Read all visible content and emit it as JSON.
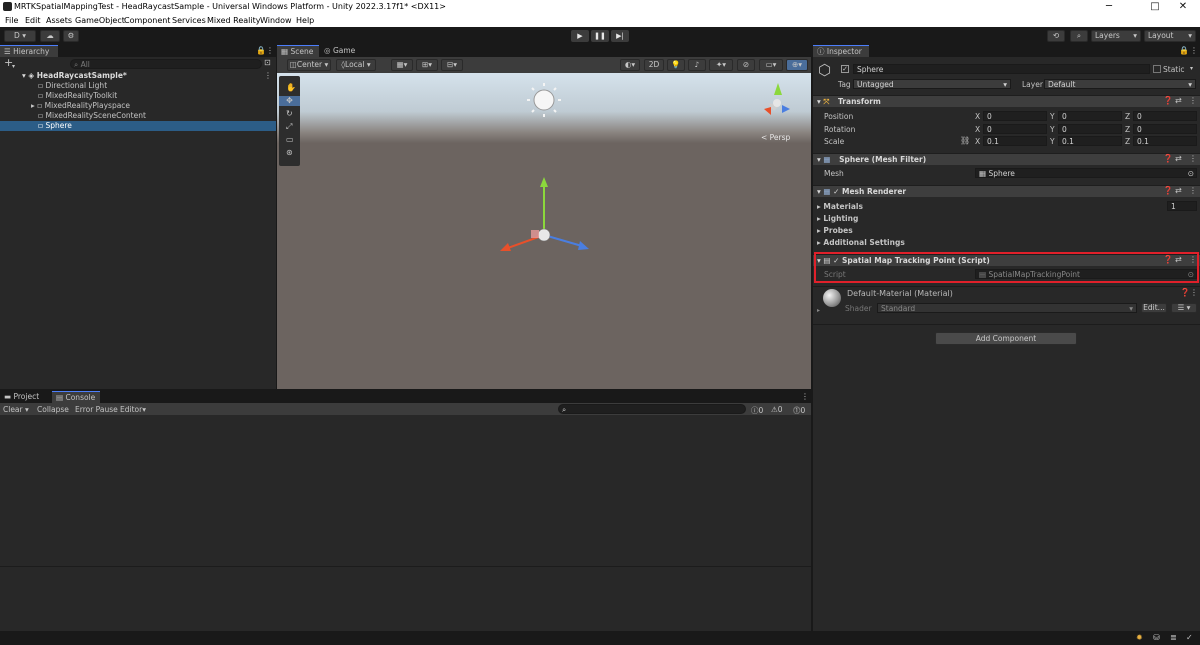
{
  "window": {
    "title": "MRTKSpatialMappingTest - HeadRaycastSample - Universal Windows Platform - Unity 2022.3.17f1* <DX11>",
    "minimize": "─",
    "maximize": "□",
    "close": "✕"
  },
  "menu": [
    "File",
    "Edit",
    "Assets",
    "GameObject",
    "Component",
    "Services",
    "Mixed Reality",
    "Window",
    "Help"
  ],
  "toolbar": {
    "account": "D ▾",
    "cloud": "☁",
    "collab": "⚙",
    "play": "▶",
    "pause": "❚❚",
    "step": "▶|",
    "history": "⟲",
    "search": "⌕",
    "layers": "Layers",
    "layout": "Layout"
  },
  "hierarchy": {
    "tab": "Hierarchy",
    "add": "+",
    "search_placeholder": "All",
    "scene": "HeadRaycastSample*",
    "items": [
      "Directional Light",
      "MixedRealityToolkit",
      "MixedRealityPlayspace",
      "MixedRealitySceneContent",
      "Sphere"
    ],
    "selected": "Sphere"
  },
  "scene": {
    "tabs": [
      "Scene",
      "Game"
    ],
    "pivot_center": "Center",
    "pivot_local": "Local",
    "mode_2d": "2D",
    "persp_label": "< Persp"
  },
  "bottom": {
    "tabs": [
      "Project",
      "Console"
    ],
    "clear": "Clear",
    "collapse": "Collapse",
    "error_pause": "Error Pause",
    "editor": "Editor",
    "count_info": "0",
    "count_warn": "0",
    "count_error": "0"
  },
  "inspector": {
    "tab": "Inspector",
    "name": "Sphere",
    "static_label": "Static",
    "tag_label": "Tag",
    "tag_value": "Untagged",
    "layer_label": "Layer",
    "layer_value": "Default",
    "transform": {
      "title": "Transform",
      "rows": [
        {
          "label": "Position",
          "x": "0",
          "y": "0",
          "z": "0"
        },
        {
          "label": "Rotation",
          "x": "0",
          "y": "0",
          "z": "0"
        },
        {
          "label": "Scale",
          "x": "0.1",
          "y": "0.1",
          "z": "0.1"
        }
      ]
    },
    "mesh_filter": {
      "title": "Sphere (Mesh Filter)",
      "mesh_label": "Mesh",
      "mesh_value": "Sphere"
    },
    "mesh_renderer": {
      "title": "Mesh Renderer",
      "sections": [
        "Materials",
        "Lighting",
        "Probes",
        "Additional Settings"
      ],
      "materials_count": "1"
    },
    "script_component": {
      "title": "Spatial Map Tracking Point (Script)",
      "script_label": "Script",
      "script_value": "SpatialMapTrackingPoint",
      "highlight_color": "#e0202a"
    },
    "material": {
      "name": "Default-Material (Material)",
      "shader_label": "Shader",
      "shader_value": "Standard",
      "edit_label": "Edit..."
    },
    "add_component": "Add Component"
  },
  "axis_labels": {
    "x": "X",
    "y": "Y",
    "z": "Z"
  },
  "colors": {
    "selection": "#2c5d87",
    "accent": "#4c7efc",
    "panel": "#282828",
    "scene_ground": "#6c6460",
    "sky": "#c8d8e6"
  }
}
